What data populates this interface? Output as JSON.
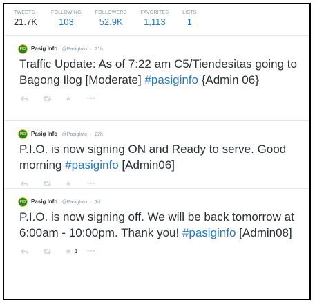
{
  "stats": [
    {
      "label": "TWEETS",
      "value": "21.7K",
      "style": "dark"
    },
    {
      "label": "FOLLOWING",
      "value": "103",
      "style": "blue"
    },
    {
      "label": "FOLLOWERS",
      "value": "52.9K",
      "style": "blue"
    },
    {
      "label": "FAVORITES",
      "value": "1,113",
      "style": "blue"
    },
    {
      "label": "LISTS",
      "value": "1",
      "style": "blue"
    }
  ],
  "tweets": [
    {
      "name": "Pasig Info",
      "handle": "@PasigInfo",
      "sep": "·",
      "time": "21h",
      "text_before": "Traffic Update: As of 7:22 am C5/Tiendesitas going to Bagong Ilog [Moderate] ",
      "hashtag": "#pasiginfo",
      "text_after": " {Admin 06}",
      "fav_count": ""
    },
    {
      "name": "Pasig Info",
      "handle": "@PasigInfo",
      "sep": "·",
      "time": "22h",
      "text_before": "P.I.O. is now signing ON and Ready to serve. Good morning ",
      "hashtag": "#pasiginfo",
      "text_after": " [Admin06]",
      "fav_count": ""
    },
    {
      "name": "Pasig Info",
      "handle": "@PasigInfo",
      "sep": "·",
      "time": "1d",
      "text_before": "P.I.O. is now signing off. We will be back tomorrow at 6:00am - 10:00pm. Thank you! ",
      "hashtag": "#pasiginfo",
      "text_after": " [Admin08]",
      "fav_count": "1"
    }
  ],
  "avatar_text": "PIO",
  "icons": {
    "reply": "reply-icon",
    "retweet": "retweet-icon",
    "favorite": "star-icon",
    "more": "more-icon"
  },
  "colors": {
    "link": "#2b7bb9",
    "muted": "#8899a6",
    "icon": "#ccd6dd",
    "avatar_bg": "#1f7f3b"
  }
}
